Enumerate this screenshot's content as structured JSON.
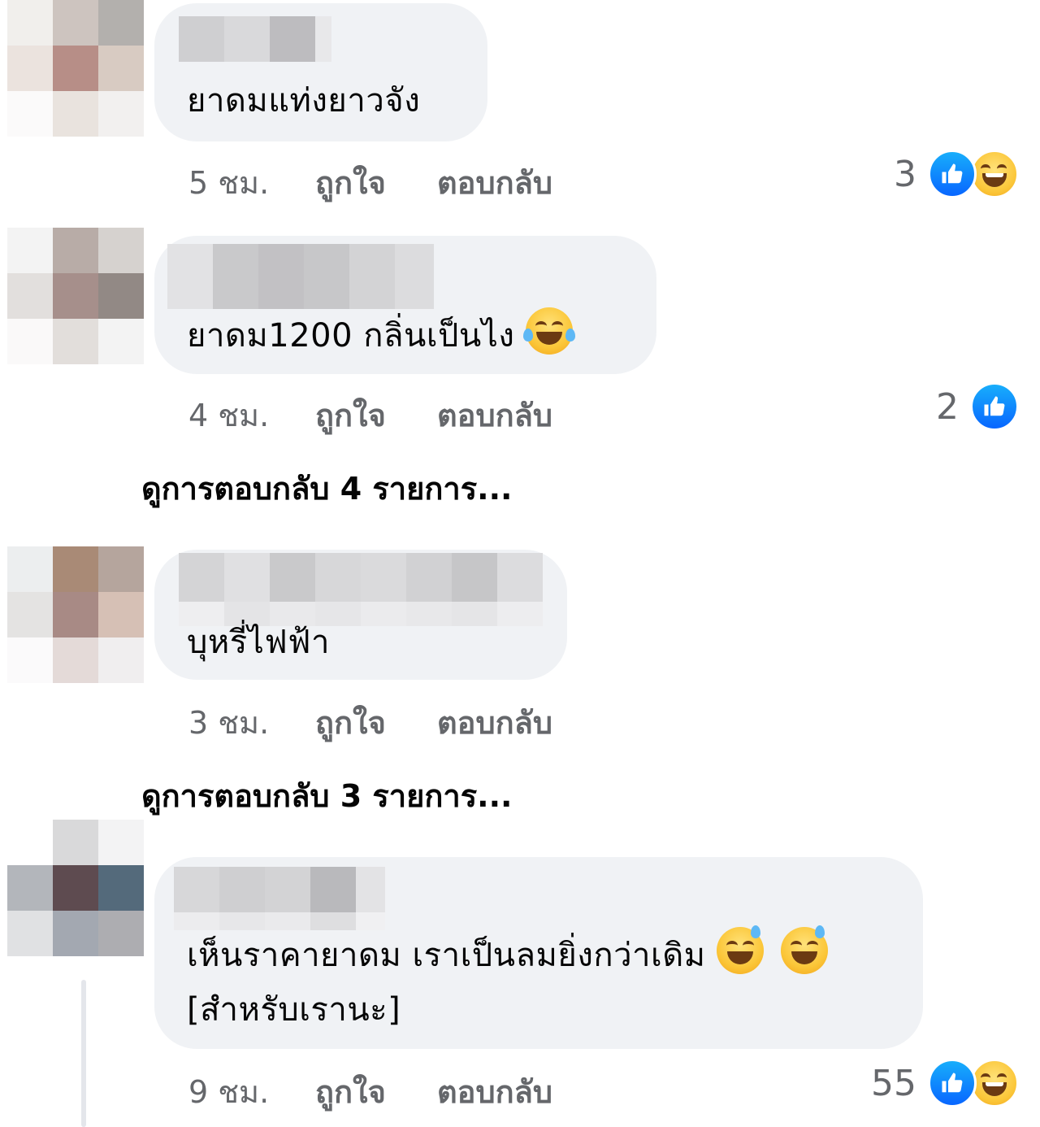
{
  "comments": [
    {
      "text": "ยาดมแท่งยาวจัง",
      "time": "5 ชม.",
      "like_label": "ถูกใจ",
      "reply_label": "ตอบกลับ",
      "reaction_count": "3",
      "reactions": [
        "like-icon",
        "haha-icon"
      ],
      "author_name_blurred": true
    },
    {
      "text": "ยาดม1200 กลิ่นเป็นไง",
      "emoji": "face-with-tears-of-joy",
      "time": "4 ชม.",
      "like_label": "ถูกใจ",
      "reply_label": "ตอบกลับ",
      "reaction_count": "2",
      "reactions": [
        "like-icon"
      ],
      "view_replies": "ดูการตอบกลับ 4 รายการ...",
      "author_name_blurred": true
    },
    {
      "text": "บุหรี่ไฟฟ้า",
      "time": "3 ชม.",
      "like_label": "ถูกใจ",
      "reply_label": "ตอบกลับ",
      "view_replies": "ดูการตอบกลับ 3 รายการ...",
      "author_name_blurred": true
    },
    {
      "text_line1": "เห็นราคายาดม เราเป็นลมยิ่งกว่าเดิม",
      "emoji": "grinning-face-with-sweat",
      "text_line2": "[สำหรับเรานะ]",
      "time": "9 ชม.",
      "like_label": "ถูกใจ",
      "reply_label": "ตอบกลับ",
      "reaction_count": "55",
      "reactions": [
        "like-icon",
        "haha-icon"
      ],
      "author_name_blurred": true
    }
  ],
  "colors": {
    "bubble_bg": "#f0f2f5",
    "meta_text": "#65676b",
    "like_blue": "#0866ff",
    "primary_text": "#050505"
  }
}
